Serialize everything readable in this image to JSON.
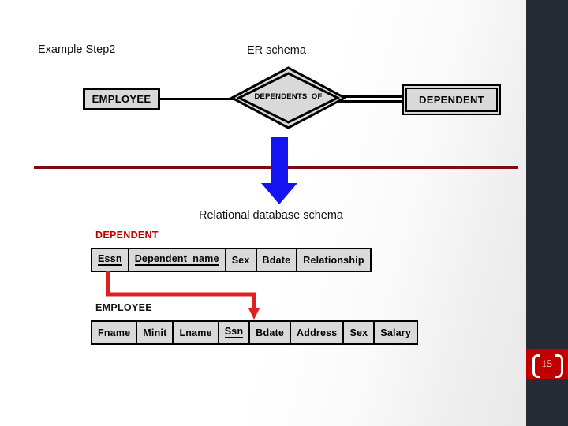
{
  "slide": {
    "title_left": "Example Step2",
    "title_er": "ER schema",
    "title_relational": "Relational database schema",
    "page_number": "15",
    "accent_red": "#c00000",
    "divider_red": "#7b0d11",
    "arrow_blue": "#1414f0",
    "sidebar_dark": "#262b35",
    "entity_fill": "#d9d9d9"
  },
  "er_diagram": {
    "employee_entity": "EMPLOYEE",
    "relationship": "DEPENDENTS_OF",
    "dependent_entity": "DEPENDENT"
  },
  "relational": {
    "dependent": {
      "label": "DEPENDENT",
      "columns": [
        {
          "name": "Essn",
          "key": true
        },
        {
          "name": "Dependent_name",
          "key": true
        },
        {
          "name": "Sex",
          "key": false
        },
        {
          "name": "Bdate",
          "key": false
        },
        {
          "name": "Relationship",
          "key": false
        }
      ]
    },
    "employee": {
      "label": "EMPLOYEE",
      "columns": [
        {
          "name": "Fname",
          "key": false
        },
        {
          "name": "Minit",
          "key": false
        },
        {
          "name": "Lname",
          "key": false
        },
        {
          "name": "Ssn",
          "key": true
        },
        {
          "name": "Bdate",
          "key": false
        },
        {
          "name": "Address",
          "key": false
        },
        {
          "name": "Sex",
          "key": false
        },
        {
          "name": "Salary",
          "key": false
        }
      ]
    }
  }
}
